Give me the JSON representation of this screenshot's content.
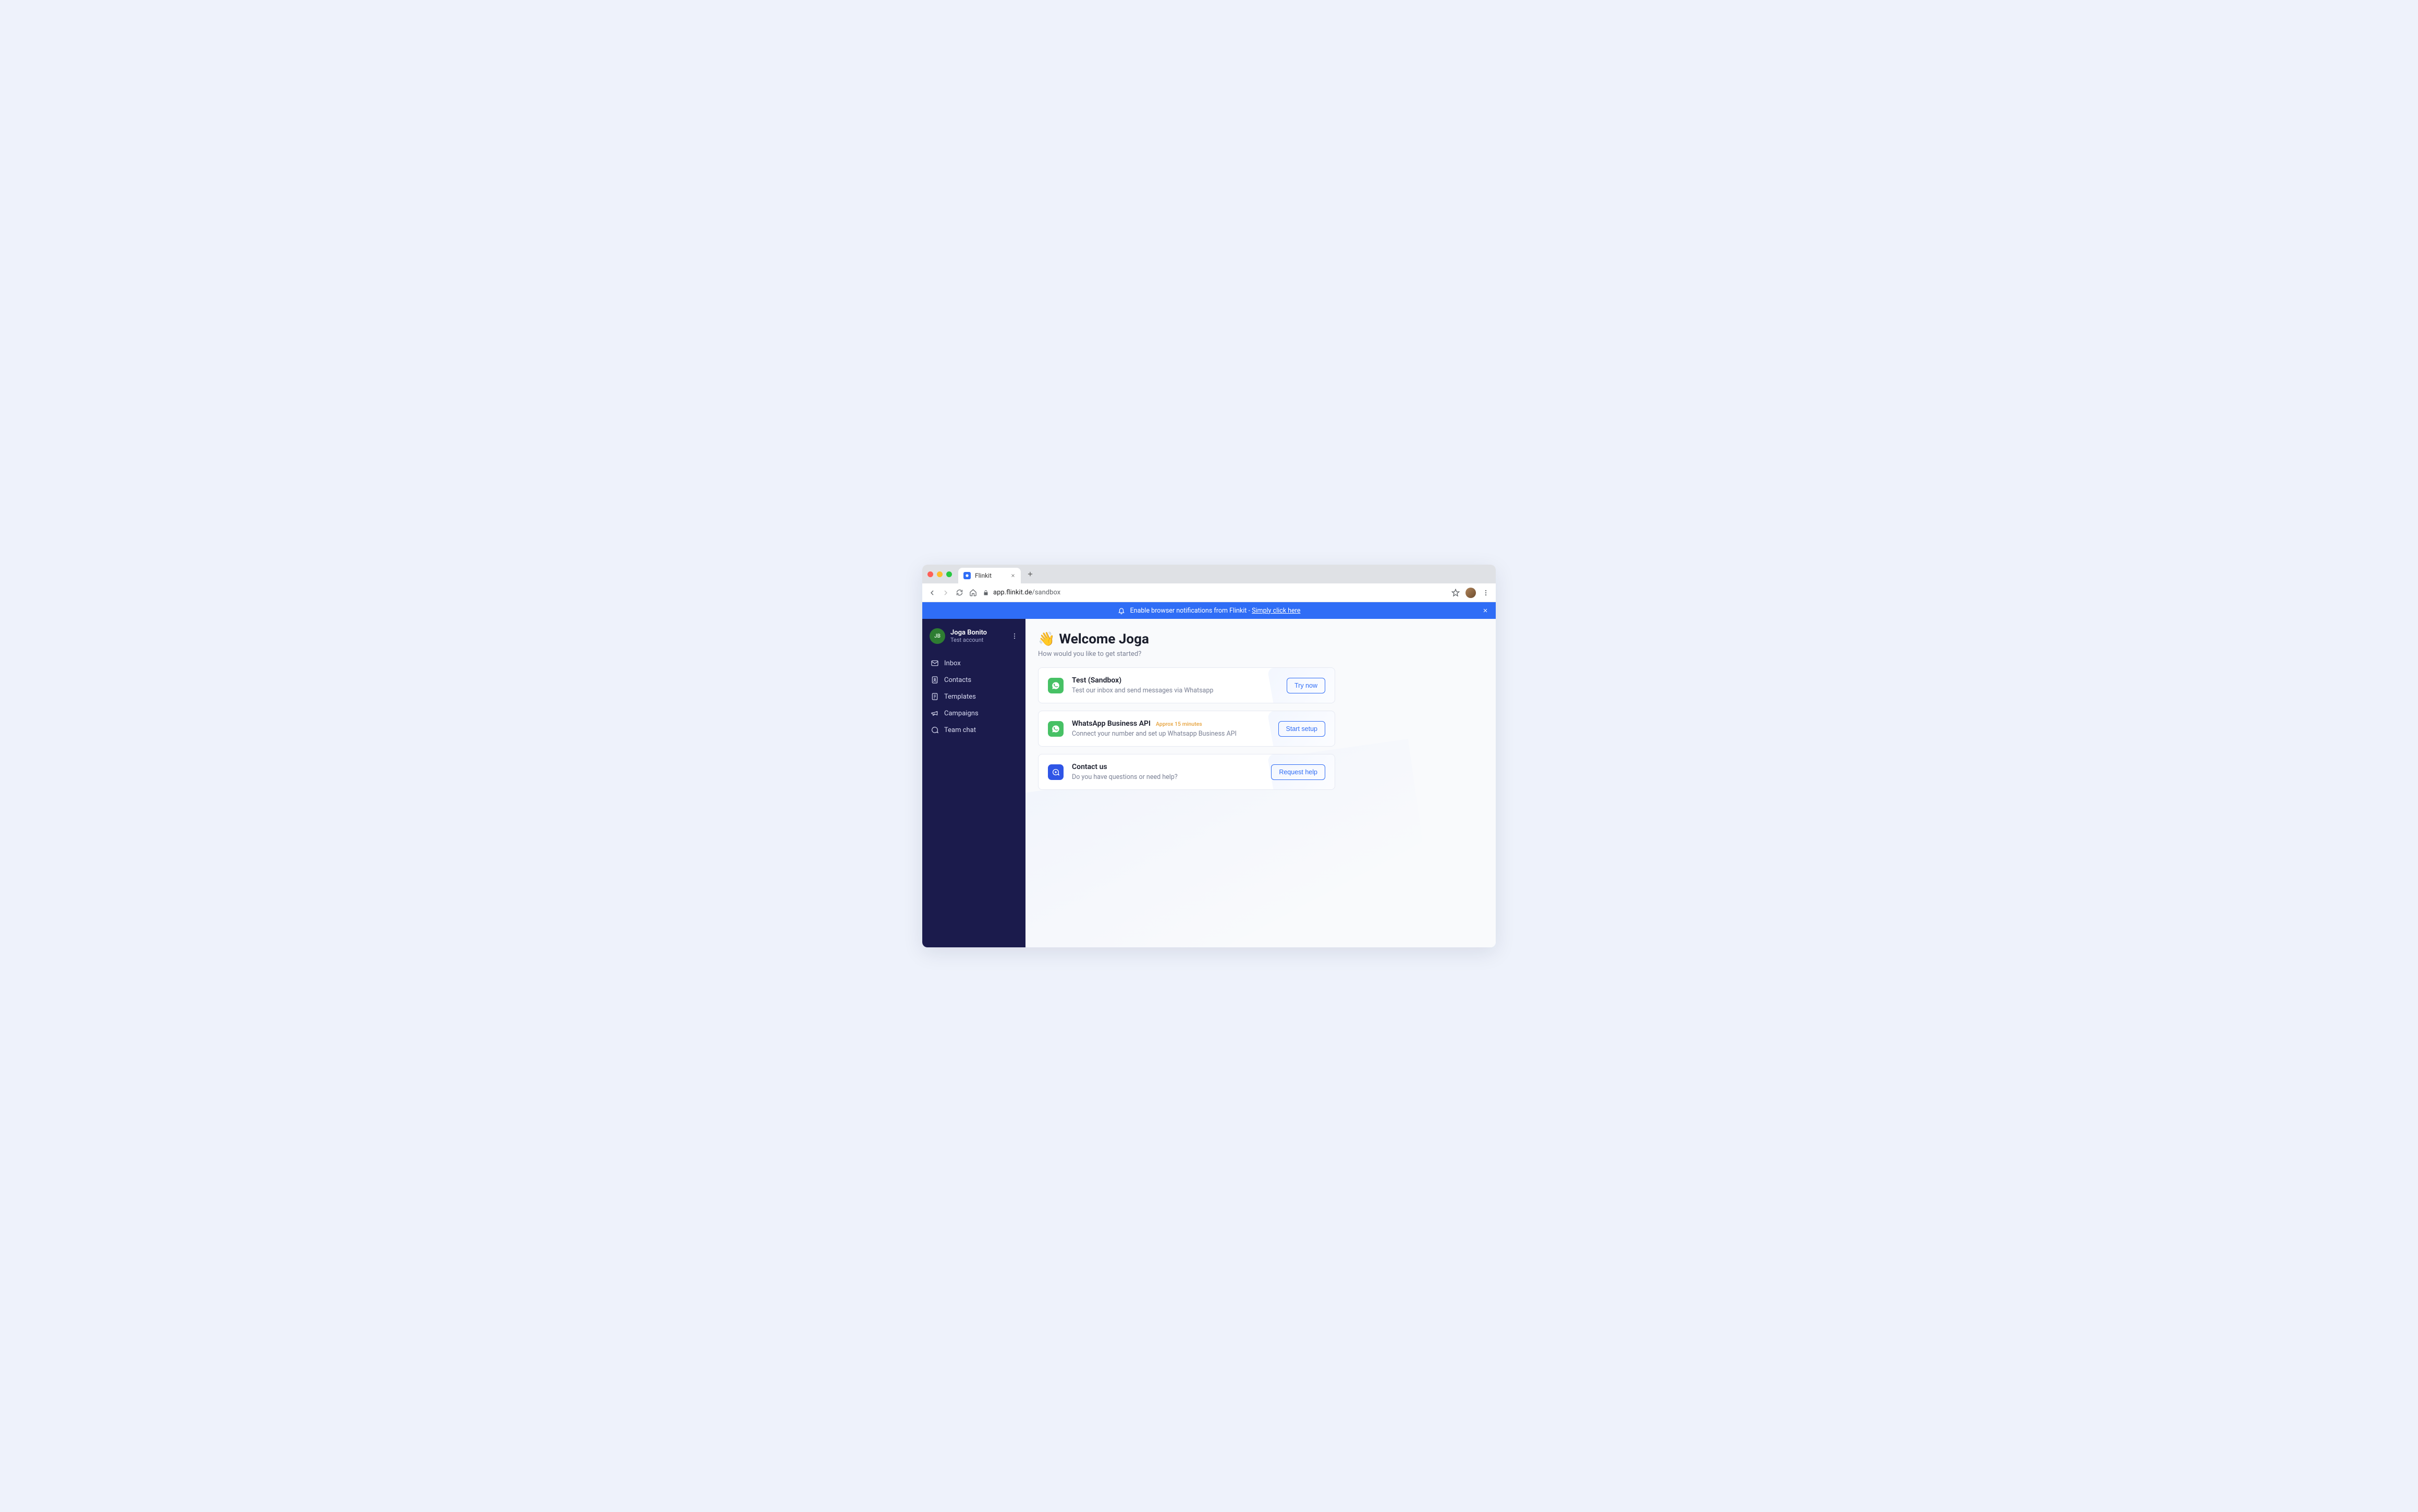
{
  "browser": {
    "tab_title": "Flinkit",
    "url_host": "app.flinkit.de",
    "url_path": "/sandbox"
  },
  "banner": {
    "text": "Enable browser notifications from Flinkit - ",
    "link": "Simply click here"
  },
  "sidebar": {
    "user": {
      "initials": "JB",
      "name": "Joga Bonito",
      "role": "Test account"
    },
    "items": [
      {
        "label": "Inbox"
      },
      {
        "label": "Contacts"
      },
      {
        "label": "Templates"
      },
      {
        "label": "Campaigns"
      },
      {
        "label": "Team chat"
      }
    ]
  },
  "welcome": {
    "heading_emoji": "👋",
    "heading": "Welcome Joga",
    "sub": "How would you like to get started?"
  },
  "cards": {
    "sandbox": {
      "title": "Test (Sandbox)",
      "sub": "Test our inbox and send messages via Whatsapp",
      "button": "Try now"
    },
    "waba": {
      "title": "WhatsApp Business API",
      "badge": "Approx 15 minutes",
      "sub": "Connect your number and set up Whatsapp Business API",
      "button": "Start setup"
    },
    "contact": {
      "title": "Contact us",
      "sub": "Do you have questions or need help?",
      "button": "Request help"
    }
  }
}
